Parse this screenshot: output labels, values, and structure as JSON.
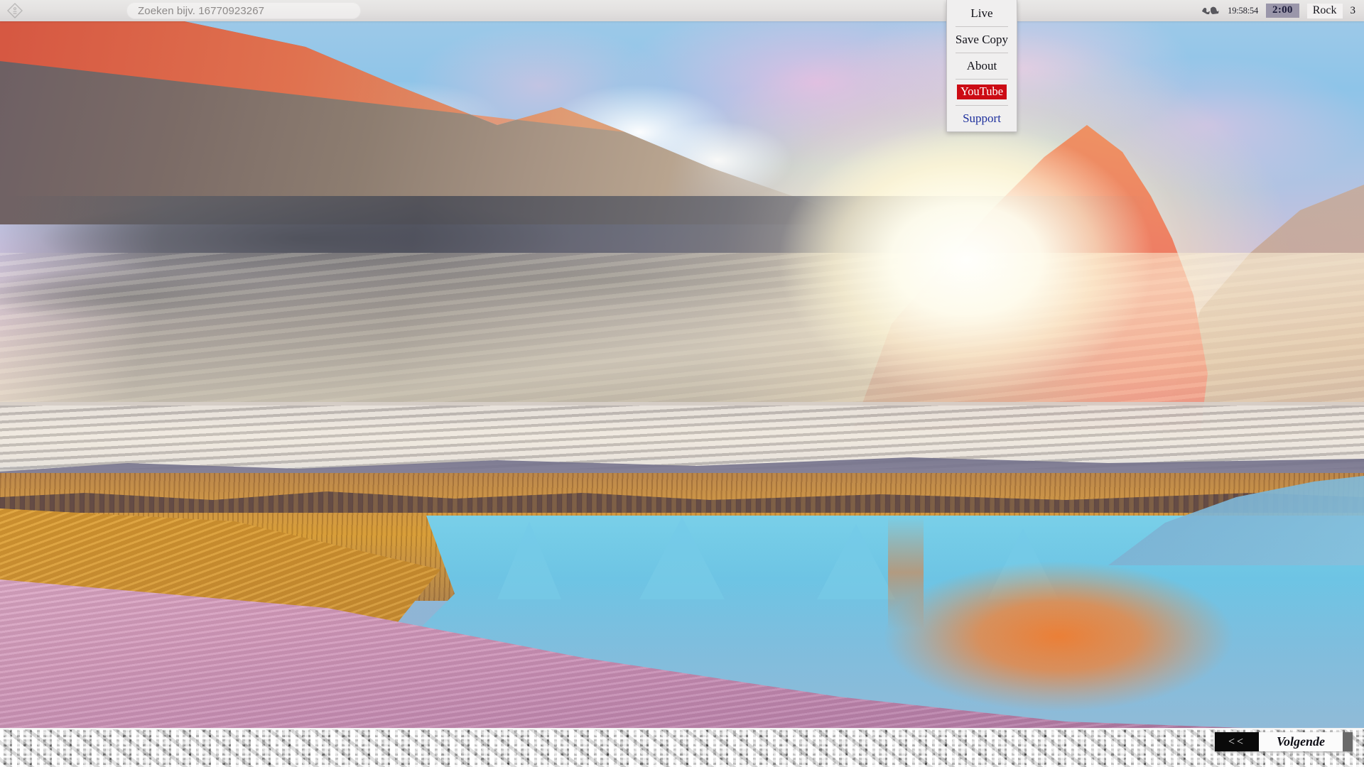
{
  "topbar": {
    "home_icon": "diamond-home-icon",
    "search": {
      "placeholder": "Zoeken bijv. 16770923267",
      "value": "Zoeken bijv. 16770923267"
    },
    "status": {
      "globe_icon": "world-globe-icon",
      "clock": "19:58:54",
      "timer": "2:00",
      "genre": "Rock",
      "count": "3",
      "timer_bg": "#9a96aa",
      "timer_text": "#1b1b3a"
    }
  },
  "menu": {
    "items": [
      {
        "label": "Live",
        "style": "plain"
      },
      {
        "label": "Save Copy",
        "style": "plain"
      },
      {
        "label": "About",
        "style": "plain"
      },
      {
        "label": "YouTube",
        "style": "chip"
      },
      {
        "label": "Support",
        "style": "link"
      }
    ],
    "chip_bg": "#cc0b14",
    "chip_text": "#ffffff",
    "link_color": "#1d2f9c"
  },
  "bottom_nav": {
    "prev_label": "<<",
    "next_label": "Volgende",
    "prev_bg": "#0a0a0a",
    "next_bg": "#fbfbfb"
  },
  "media": {
    "scene": "sunset-mountain-lake-landscape",
    "glitch_strip": "corrupted-video-scanline-band"
  }
}
